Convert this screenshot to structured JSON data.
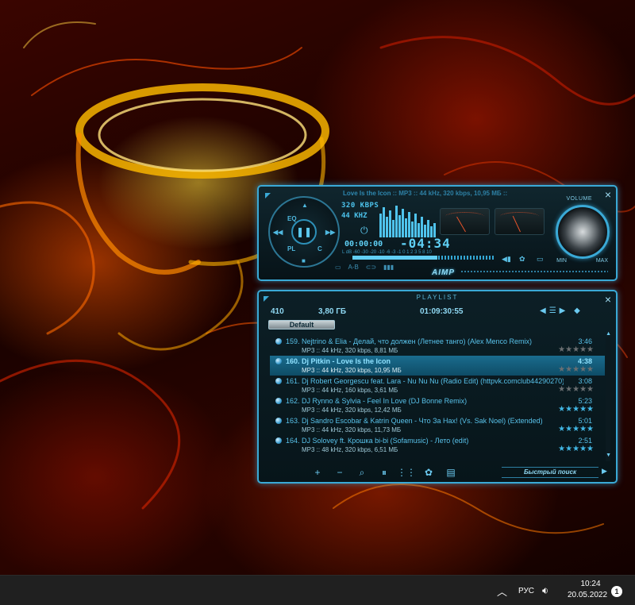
{
  "player": {
    "track_line_name": "Love Is the Icon",
    "track_line_info": " :: MP3 :: 44 kHz, 320 kbps, 10,95 МБ ::",
    "bitrate": "320 KBPS",
    "samplerate": "44 KHZ",
    "elapsed": "00:00:00",
    "remaining": "-04:34",
    "eq_scale": "L  dB -60  -30  -20  -10   -6   -3   -1   0   1   2   3   5   8   10",
    "volume_label": "VOLUME",
    "vol_min": "MIN",
    "vol_max": "MAX",
    "ab_label": "A-B",
    "logo": "AIMP",
    "wheel": {
      "eq": "EQ",
      "pl": "PL",
      "c": "C",
      "pause": "❚❚"
    }
  },
  "playlist": {
    "title": "PLAYLIST",
    "count": "410",
    "size": "3,80 ГБ",
    "duration": "01:09:30:55",
    "tab": "Default",
    "quick_search": "Быстрый поиск",
    "rows": [
      {
        "title": "159. Nejtrino & Elia - Делай, что должен (Летнее танго) (Alex Menco Remix)",
        "meta": "MP3 :: 44 kHz, 320 kbps, 8,81 МБ",
        "dur": "3:46",
        "stars": "★★★★★",
        "rating": 0
      },
      {
        "title": "160. Dj Pitkin - Love Is the Icon",
        "meta": "MP3 :: 44 kHz, 320 kbps, 10,95 МБ",
        "dur": "4:38",
        "stars": "★★★★★",
        "rating": 0
      },
      {
        "title": "161. Dj Robert Georgescu feat. Lara - Nu Nu Nu (Radio Edit) (httpvk.comclub44290270)",
        "meta": "MP3 :: 44 kHz, 160 kbps, 3,61 МБ",
        "dur": "3:08",
        "stars": "★★★★★",
        "rating": 0
      },
      {
        "title": "162. DJ Rynno & Sylvia - Feel In Love (DJ Bonne Remix)",
        "meta": "MP3 :: 44 kHz, 320 kbps, 12,42 МБ",
        "dur": "5:23",
        "stars": "★★★★★",
        "rating": 5
      },
      {
        "title": "163. Dj Sandro Escobar & Katrin Queen - Что За Нах! (Vs. Sak Noel) (Extended)",
        "meta": "MP3 :: 44 kHz, 320 kbps, 11,73 МБ",
        "dur": "5:01",
        "stars": "★★★★★",
        "rating": 5
      },
      {
        "title": "164. DJ Solovey ft. Крошка bi-bi (Sofamusic) - Лето (edit)",
        "meta": "MP3 :: 48 kHz, 320 kbps, 6,51 МБ",
        "dur": "2:51",
        "stars": "★★★★★",
        "rating": 5
      }
    ]
  },
  "taskbar": {
    "lang": "РУС",
    "time": "10:24",
    "date": "20.05.2022",
    "notifications": "1"
  },
  "colors": {
    "accent": "#3aa9d6",
    "accent_text": "#58c2ea",
    "taskbar": "#202020"
  },
  "icons": [
    "close-icon",
    "play-pause-icon",
    "volume-knob-icon",
    "speaker-icon",
    "chevron-up-icon",
    "add-icon",
    "remove-icon",
    "search-icon"
  ]
}
